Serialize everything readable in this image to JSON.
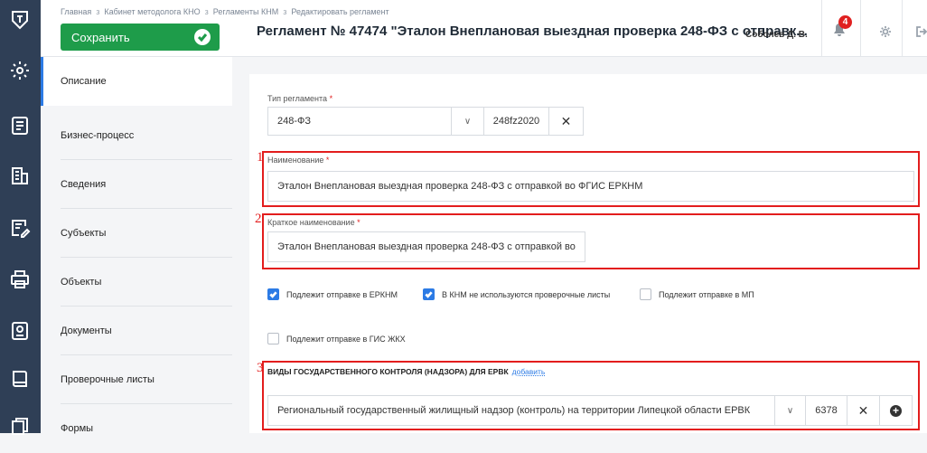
{
  "breadcrumbs": [
    "Главная",
    "Кабинет методолога КНО",
    "Регламенты КНМ",
    "Редактировать регламент"
  ],
  "crumb_sep": "з",
  "toolbar": {
    "save_label": "Сохранить"
  },
  "page_title": "Регламент № 47474 \"Эталон Внеплановая выездная проверка 248-ФЗ с отправк...",
  "user_name": "Соболев Д. В.",
  "notifications_count": "4",
  "sidebar_icons": [
    "logo-shield-icon",
    "settings-icon",
    "document-icon",
    "building-icon",
    "checklist-edit-icon",
    "printer-icon",
    "report-icon",
    "book-icon",
    "files-icon"
  ],
  "nav": {
    "items": [
      {
        "label": "Описание",
        "active": true
      },
      {
        "label": "Бизнес-процесс",
        "active": false
      },
      {
        "label": "Сведения",
        "active": false
      },
      {
        "label": "Субъекты",
        "active": false
      },
      {
        "label": "Объекты",
        "active": false
      },
      {
        "label": "Документы",
        "active": false
      },
      {
        "label": "Проверочные листы",
        "active": false
      },
      {
        "label": "Формы",
        "active": false
      }
    ]
  },
  "form": {
    "type_label": "Тип регламента",
    "type_value": "248-ФЗ",
    "type_code": "248fz2020",
    "name_label": "Наименование",
    "name_value": "Эталон Внеплановая выездная проверка 248-ФЗ с отправкой во ФГИС ЕРКНМ",
    "short_label": "Краткое наименование",
    "short_value": "Эталон Внеплановая выездная проверка 248-ФЗ с отправкой во",
    "required_mark": "*",
    "checkboxes": [
      {
        "label": "Подлежит отправке в ЕРКНМ",
        "checked": true
      },
      {
        "label": "В КНМ не используются проверочные листы",
        "checked": true
      },
      {
        "label": "Подлежит отправке в МП",
        "checked": false
      },
      {
        "label": "Подлежит отправке в ГИС ЖКХ",
        "checked": false
      }
    ],
    "section_title": "ВИДЫ ГОСУДАРСТВЕННОГО КОНТРОЛЯ (НАДЗОРА) ДЛЯ ЕРВК",
    "section_add": "добавить",
    "control_value": "Региональный государственный жилищный надзор (контроль) на территории Липецкой области ЕРВК",
    "control_code": "6378"
  },
  "annotations": [
    "1",
    "2",
    "3"
  ],
  "colors": {
    "rail": "#2f3f56",
    "save": "#1e9c4a",
    "accent": "#2c7be5",
    "highlight": "#e31d1d"
  }
}
